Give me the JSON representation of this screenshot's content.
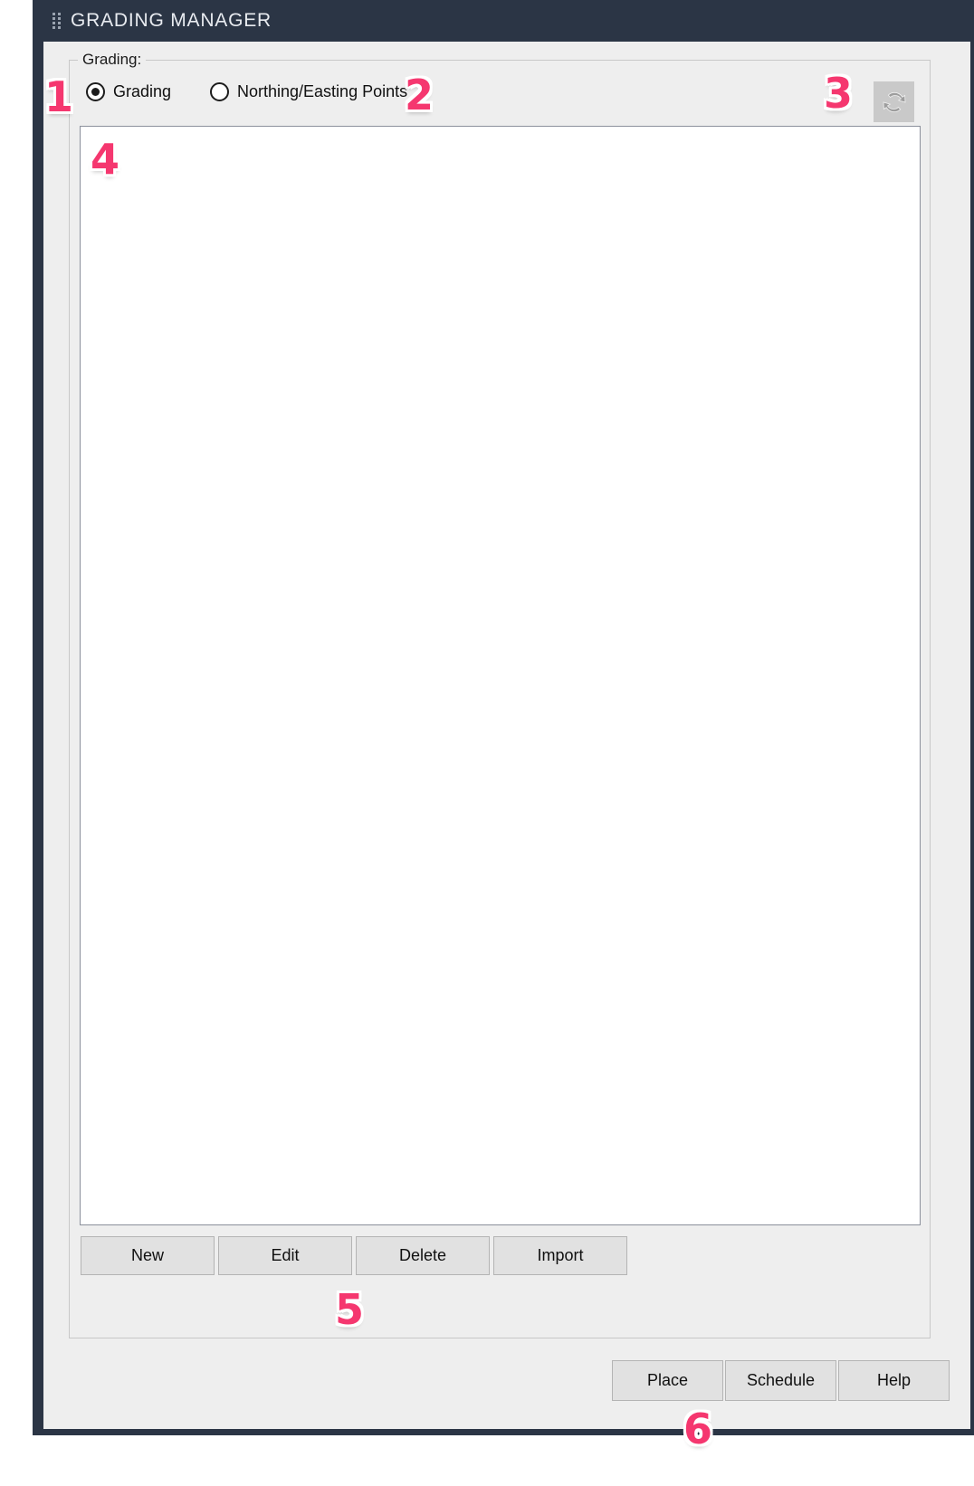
{
  "window": {
    "title": "GRADING MANAGER",
    "grip_icon": "drag-grip-icon",
    "titlebar_color": "#2b3545"
  },
  "group": {
    "legend": "Grading:"
  },
  "radios": [
    {
      "label": "Grading",
      "checked": true
    },
    {
      "label": "Northing/Easting Points",
      "checked": false
    }
  ],
  "toolbar": {
    "refresh_icon": "refresh-icon",
    "refresh_title": "Refresh",
    "refresh_enabled": false
  },
  "list": {
    "items": [],
    "empty_text": ""
  },
  "actions": [
    {
      "label": "New"
    },
    {
      "label": "Edit"
    },
    {
      "label": "Delete"
    },
    {
      "label": "Import"
    }
  ],
  "footer_buttons": [
    {
      "label": "Place"
    },
    {
      "label": "Schedule"
    },
    {
      "label": "Help"
    }
  ],
  "annotations": {
    "accent_color": "#f5376f",
    "markers": [
      {
        "id": "1",
        "text": "1"
      },
      {
        "id": "2",
        "text": "2"
      },
      {
        "id": "3",
        "text": "3"
      },
      {
        "id": "4",
        "text": "4"
      },
      {
        "id": "5",
        "text": "5"
      },
      {
        "id": "6",
        "text": "6"
      }
    ]
  }
}
